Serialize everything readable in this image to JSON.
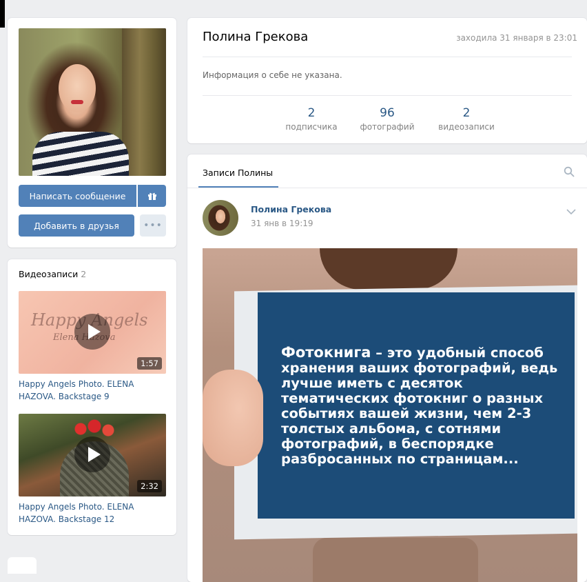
{
  "profile": {
    "name": "Полина Грекова",
    "last_seen": "заходила 31 января в 23:01",
    "about": "Информация о себе не указана.",
    "stats": [
      {
        "value": "2",
        "label": "подписчика"
      },
      {
        "value": "96",
        "label": "фотографий"
      },
      {
        "value": "2",
        "label": "видеозаписи"
      }
    ]
  },
  "actions": {
    "send_message": "Написать сообщение",
    "add_friend": "Добавить в друзья",
    "more": "•••"
  },
  "videos": {
    "title": "Видеозаписи",
    "count": "2",
    "items": [
      {
        "title": "Happy Angels Photo. ELENA HAZOVA. Backstage 9",
        "duration": "1:57"
      },
      {
        "title": "Happy Angels Photo. ELENA HAZOVA. Backstage 12",
        "duration": "2:32"
      }
    ]
  },
  "wall": {
    "tab": "Записи Полины",
    "post": {
      "author": "Полина Грекова",
      "time": "31 янв в 19:19",
      "image_text_lead": "Фотокнига",
      "image_text_rest": " – это удобный способ хранения ваших фотографий, ведь лучше иметь с десяток тематических фотокниг о разных событиях вашей жизни, чем 2-3 толстых альбома, с сотнями фотографий, в беспорядке разбросанных по страницам..."
    }
  },
  "colors": {
    "accent": "#5181b8",
    "link": "#2a5885",
    "background": "#edeef0"
  }
}
